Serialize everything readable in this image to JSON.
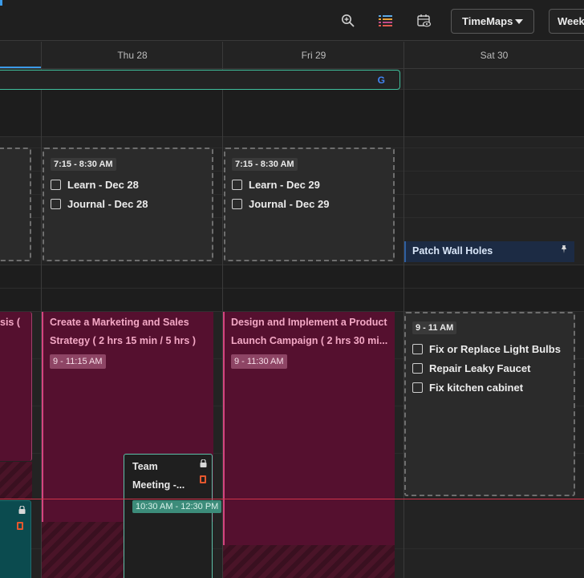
{
  "toolbar": {
    "zoom_icon": "zoom-in-icon",
    "list_icon": "colored-list-icon",
    "calendar_view_icon": "calendar-eye-icon",
    "view_mode_label": "TimeMaps",
    "range_label": "Week"
  },
  "days": [
    {
      "label": "Thu 28"
    },
    {
      "label": "Fri 29"
    },
    {
      "label": "Sat 30"
    }
  ],
  "google_event": {
    "badge": "G",
    "colors": [
      "#4285F4",
      "#EA4335",
      "#FBBC05",
      "#34A853"
    ]
  },
  "routine_blocks": [
    {
      "time": "7:15 - 8:30 AM",
      "tasks": [
        "Learn - Dec 28",
        "Journal - Dec 28"
      ]
    },
    {
      "time": "7:15 - 8:30 AM",
      "tasks": [
        "Learn - Dec 29",
        "Journal - Dec 29"
      ]
    }
  ],
  "patch_event": {
    "title": "Patch Wall Holes",
    "icon": "pin-icon"
  },
  "left_partial_event": {
    "title": "sis ("
  },
  "events": [
    {
      "title": "Create a Marketing and Sales Strategy ( 2 hrs 15 min / 5 hrs )",
      "time": "9 - 11:15 AM"
    },
    {
      "title": "Design and Implement a Product Launch Campaign ( 2 hrs 30 mi...",
      "time": "9 - 11:30 AM"
    }
  ],
  "home_block": {
    "time": "9 - 11 AM",
    "tasks": [
      "Fix or Replace Light Bulbs",
      "Repair Leaky Faucet",
      "Fix kitchen cabinet"
    ]
  },
  "meeting": {
    "title_line1": "Team",
    "title_line2": "Meeting -...",
    "time": "10:30 AM - 12:30 PM"
  },
  "colors": {
    "accent_magenta": "#d4457f",
    "event_bg": "#55102f",
    "teal": "#5ec0a8",
    "now_line": "#d0334a",
    "blue_event": "#1c2b44"
  }
}
